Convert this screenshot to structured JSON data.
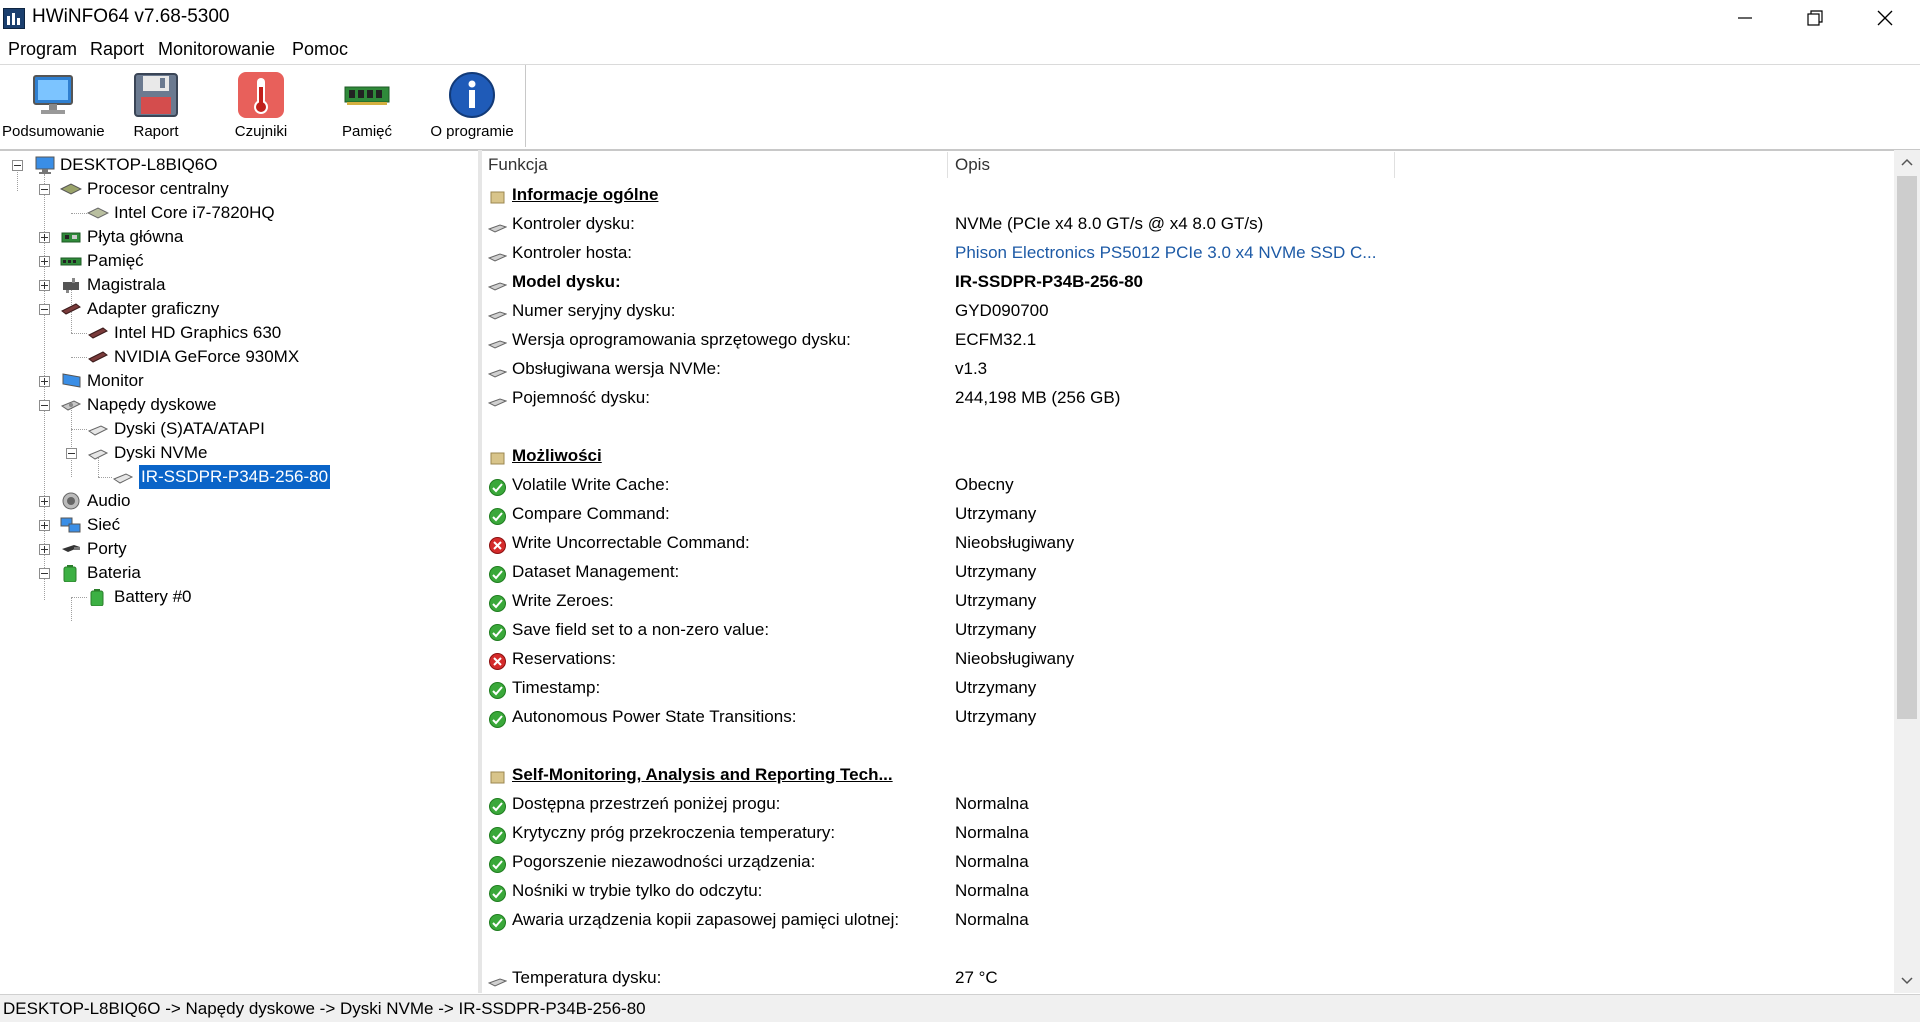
{
  "window": {
    "title": "HWiNFO64 v7.68-5300"
  },
  "menu": [
    "Program",
    "Raport",
    "Monitorowanie",
    "Pomoc"
  ],
  "toolbar": {
    "buttons": [
      {
        "label": "Podsumowanie",
        "icon": "monitor-icon"
      },
      {
        "label": "Raport",
        "icon": "floppy-disk-icon"
      },
      {
        "label": "Czujniki",
        "icon": "thermometer-icon"
      },
      {
        "label": "Pamięć",
        "icon": "memory-module-icon"
      },
      {
        "label": "O programie",
        "icon": "info-icon"
      }
    ]
  },
  "tree": {
    "root": "DESKTOP-L8BIQ6O",
    "cpu": "Procesor centralny",
    "cpu_item": "Intel Core i7-7820HQ",
    "motherboard": "Płyta główna",
    "memory": "Pamięć",
    "bus": "Magistrala",
    "gpu": "Adapter graficzny",
    "gpu_item1": "Intel HD Graphics 630",
    "gpu_item2": "NVIDIA GeForce 930MX",
    "monitor": "Monitor",
    "drives": "Napędy dyskowe",
    "sata": "Dyski (S)ATA/ATAPI",
    "nvme": "Dyski NVMe",
    "nvme_item": "IR-SSDPR-P34B-256-80",
    "audio": "Audio",
    "network": "Sieć",
    "ports": "Porty",
    "battery": "Bateria",
    "battery_item": "Battery #0"
  },
  "details": {
    "columns": {
      "function": "Funkcja",
      "description": "Opis"
    },
    "general_section": "Informacje ogólne",
    "general": [
      {
        "label": "Kontroler dysku:",
        "value": "NVMe (PCIe x4 8.0 GT/s @ x4 8.0 GT/s)"
      },
      {
        "label": "Kontroler hosta:",
        "value": "Phison Electronics PS5012 PCIe 3.0 x4 NVMe SSD C..."
      },
      {
        "label": "Model dysku:",
        "value": "IR-SSDPR-P34B-256-80"
      },
      {
        "label": "Numer seryjny dysku:",
        "value": "GYD090700"
      },
      {
        "label": "Wersja oprogramowania sprzętowego dysku:",
        "value": "ECFM32.1"
      },
      {
        "label": "Obsługiwana wersja NVMe:",
        "value": "v1.3"
      },
      {
        "label": "Pojemność dysku:",
        "value": "244,198 MB (256 GB)"
      }
    ],
    "features_section": "Możliwości",
    "features": [
      {
        "label": "Volatile Write Cache:",
        "value": "Obecny",
        "status": "ok"
      },
      {
        "label": "Compare Command:",
        "value": "Utrzymany",
        "status": "ok"
      },
      {
        "label": "Write Uncorrectable Command:",
        "value": "Nieobsługiwany",
        "status": "error"
      },
      {
        "label": "Dataset Management:",
        "value": "Utrzymany",
        "status": "ok"
      },
      {
        "label": "Write Zeroes:",
        "value": "Utrzymany",
        "status": "ok"
      },
      {
        "label": "Save field set to a non-zero value:",
        "value": "Utrzymany",
        "status": "ok"
      },
      {
        "label": "Reservations:",
        "value": "Nieobsługiwany",
        "status": "error"
      },
      {
        "label": "Timestamp:",
        "value": "Utrzymany",
        "status": "ok"
      },
      {
        "label": "Autonomous Power State Transitions:",
        "value": "Utrzymany",
        "status": "ok"
      }
    ],
    "smart_section": "Self-Monitoring, Analysis and Reporting Tech...",
    "smart": [
      {
        "label": "Dostępna przestrzeń poniżej progu:",
        "value": "Normalna",
        "status": "ok"
      },
      {
        "label": "Krytyczny próg przekroczenia temperatury:",
        "value": "Normalna",
        "status": "ok"
      },
      {
        "label": "Pogorszenie niezawodności urządzenia:",
        "value": "Normalna",
        "status": "ok"
      },
      {
        "label": "Nośniki w trybie tylko do odczytu:",
        "value": "Normalna",
        "status": "ok"
      },
      {
        "label": "Awaria urządzenia kopii zapasowej pamięci ulotnej:",
        "value": "Normalna",
        "status": "ok"
      }
    ],
    "temperature": {
      "label": "Temperatura dysku:",
      "value": "27 °C"
    }
  },
  "status_bar": "DESKTOP-L8BIQ6O -> Napędy dyskowe -> Dyski NVMe -> IR-SSDPR-P34B-256-80",
  "colors": {
    "selection": "#0a64c8",
    "link": "#1d5aa6",
    "ok": "#3aa83a",
    "error": "#d42b2b"
  }
}
